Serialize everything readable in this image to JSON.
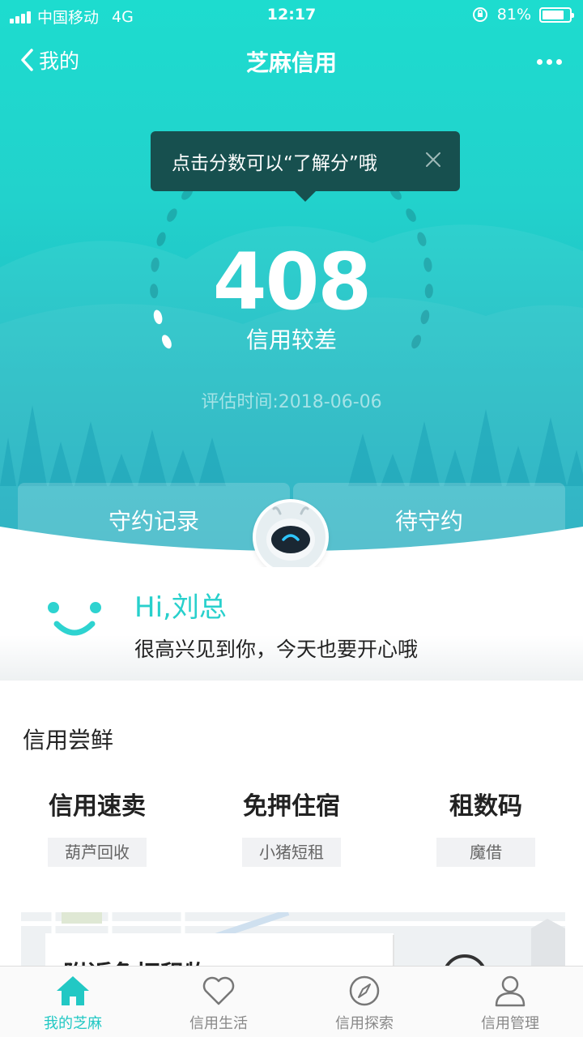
{
  "status_bar": {
    "carrier": "中国移动",
    "network": "4G",
    "time": "12:17",
    "battery_text": "81%",
    "battery_level": 0.81
  },
  "nav": {
    "back_label": "我的",
    "title": "芝麻信用"
  },
  "tooltip": {
    "text": "点击分数可以“了解分”哦"
  },
  "score": {
    "value": "408",
    "level": "信用较差",
    "eval_time": "评估时间:2018-06-06"
  },
  "tabs": {
    "left": "守约记录",
    "right": "待守约"
  },
  "greeting": {
    "hi": "Hi,刘总",
    "message": "很高兴见到你，今天也要开心哦"
  },
  "credit_try": {
    "title": "信用尝鲜",
    "items": [
      {
        "name": "信用速卖",
        "tag": "葫芦回收"
      },
      {
        "name": "免押住宿",
        "tag": "小猪短租"
      },
      {
        "name": "租数码",
        "tag": "魔借"
      }
    ]
  },
  "map_card": {
    "title": "附近免押租物"
  },
  "tab_bar": {
    "items": [
      {
        "label": "我的芝麻",
        "icon": "home-icon"
      },
      {
        "label": "信用生活",
        "icon": "heart-icon"
      },
      {
        "label": "信用探索",
        "icon": "compass-icon"
      },
      {
        "label": "信用管理",
        "icon": "user-icon"
      }
    ]
  },
  "colors": {
    "accent": "#22c8c4",
    "tooltip_bg": "#17504f"
  }
}
